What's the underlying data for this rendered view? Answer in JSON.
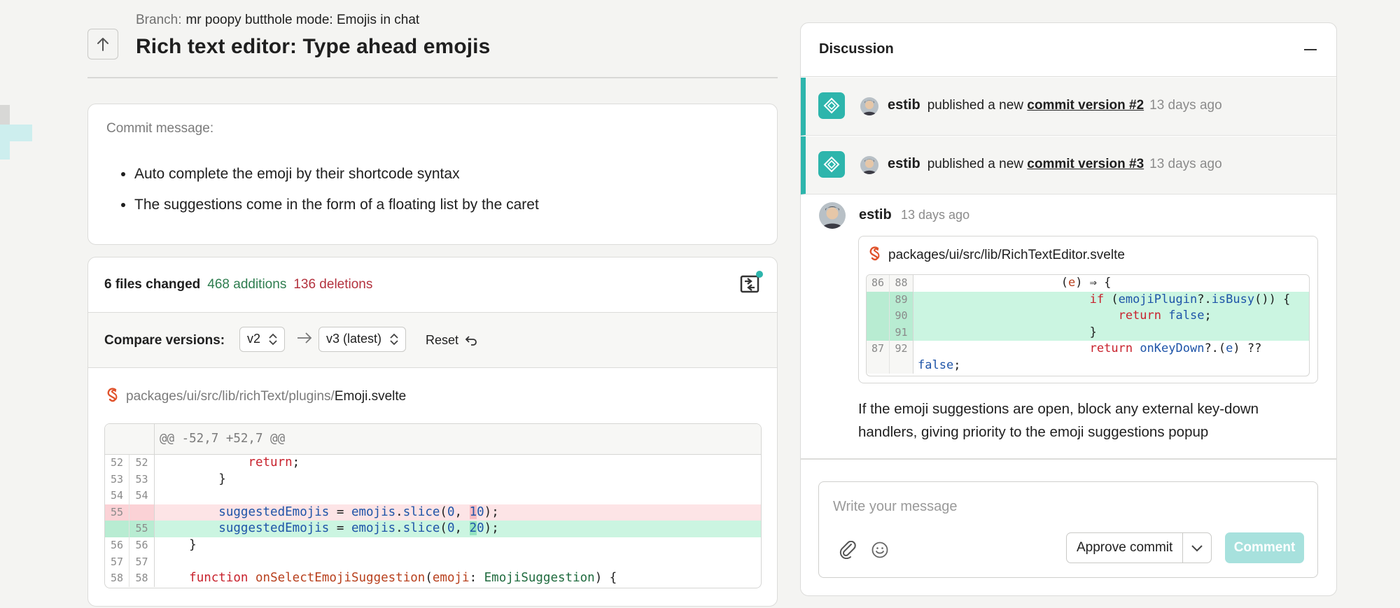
{
  "header": {
    "branch_label": "Branch:",
    "branch_name": "mr poopy butthole mode: Emojis in chat",
    "title": "Rich text editor: Type ahead emojis"
  },
  "commit": {
    "label": "Commit message:",
    "bullets": [
      "Auto complete the emoji by their shortcode syntax",
      "The suggestions come in the form of a floating list by the caret"
    ]
  },
  "files": {
    "files_changed": "6 files changed",
    "additions": "468 additions",
    "deletions": "136 deletions",
    "compare_label": "Compare versions:",
    "from_version": "v2",
    "to_version": "v3 (latest)",
    "reset_label": "Reset",
    "path_dir": "packages/ui/src/lib/richText/plugins/",
    "path_file": "Emoji.svelte",
    "hunk": "@@ -52,7 +52,7 @@",
    "line_numbers": {
      "r1": [
        "52",
        "52"
      ],
      "r2": [
        "53",
        "53"
      ],
      "r3": [
        "54",
        "54"
      ],
      "r4": [
        "55",
        ""
      ],
      "r5": [
        "",
        "55"
      ],
      "r6": [
        "56",
        "56"
      ],
      "r7": [
        "57",
        "57"
      ],
      "r8": [
        "58",
        "58"
      ]
    }
  },
  "discussion": {
    "title": "Discussion",
    "events": [
      {
        "user": "estib",
        "action": "published a new",
        "link": "commit version #2",
        "time": "13 days ago"
      },
      {
        "user": "estib",
        "action": "published a new",
        "link": "commit version #3",
        "time": "13 days ago"
      }
    ],
    "comment": {
      "user": "estib",
      "time": "13 days ago",
      "snippet_path": "packages/ui/src/lib/RichTextEditor.svelte",
      "snippet_lines": {
        "r1": [
          "86",
          "88"
        ],
        "r2": [
          "",
          "89"
        ],
        "r3": [
          "",
          "90"
        ],
        "r4": [
          "",
          "91"
        ],
        "r5": [
          "87",
          "92"
        ]
      },
      "body": "If the emoji suggestions are open, block any external key-down handlers, giving priority to the emoji suggestions popup"
    },
    "compose": {
      "placeholder": "Write your message",
      "approve_label": "Approve commit",
      "comment_label": "Comment"
    }
  },
  "colors": {
    "accent": "#2db5ac",
    "additions": "#2e7d4f",
    "deletions": "#b3323e"
  }
}
